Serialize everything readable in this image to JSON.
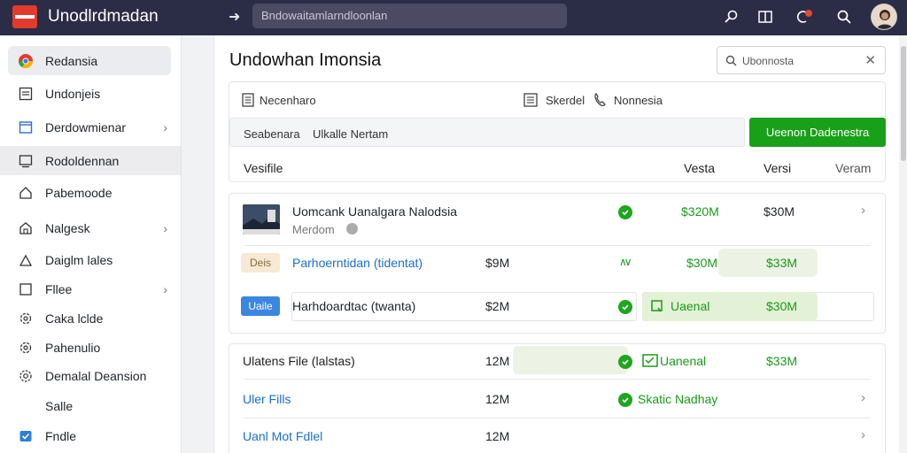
{
  "app": {
    "title": "Unodlrdmadan"
  },
  "search": {
    "placeholder": "Bndowaitamlarndloonlan"
  },
  "sidebar": {
    "items": [
      {
        "label": "Redansia",
        "icon": "chrome-icon",
        "chevron": false
      },
      {
        "label": "Undonjeis",
        "icon": "document-icon",
        "chevron": false
      },
      {
        "label": "Derdowmienar",
        "icon": "window-icon",
        "chevron": true
      },
      {
        "label": "Rodoldennan",
        "icon": "monitor-icon",
        "chevron": false
      },
      {
        "label": "Pabemoode",
        "icon": "home-icon",
        "chevron": false
      },
      {
        "label": "Nalgesk",
        "icon": "house-icon",
        "chevron": true
      },
      {
        "label": "Daiglm lales",
        "icon": "user-icon",
        "chevron": false
      },
      {
        "label": "Fllee",
        "icon": "square-icon",
        "chevron": true
      },
      {
        "label": "Caka lclde",
        "icon": "gear-icon",
        "chevron": false
      },
      {
        "label": "Pahenulio",
        "icon": "gear-icon",
        "chevron": false
      },
      {
        "label": "Demalal Deansion",
        "icon": "cog-icon",
        "chevron": false
      },
      {
        "label": "Salle",
        "icon": "",
        "chevron": false
      },
      {
        "label": "Fndle",
        "icon": "checkbox-icon",
        "chevron": false
      }
    ]
  },
  "main": {
    "title": "Undowhan Imonsia",
    "filter": {
      "value": "Ubonnosta"
    },
    "toolbar": {
      "item1": "Necenharo",
      "item2": "Skerdel",
      "item3": "Nonnesia",
      "sub1": "Seabenara",
      "sub2": "Ulkalle Nertam",
      "button": "Ueenon Dadenestra"
    },
    "headers": {
      "c1": "Vesifile",
      "c2": "Vesta",
      "c3": "Versi",
      "c4": "Veram"
    },
    "group1": {
      "row1": {
        "name": "Uomcank Uanalgara Nalodsia",
        "sub": "Merdom",
        "v1": "$320M",
        "v2": "$30M"
      },
      "row2": {
        "badge": "Deis",
        "name": "Parhoerntidan (tidentat)",
        "size": "$9M",
        "mark": "∧∨",
        "v1": "$30M",
        "v2": "$33M"
      },
      "row3": {
        "badge": "Uaile",
        "name": "Harhdoardtac (twanta)",
        "size": "$2M",
        "status": "Uaenal",
        "v2": "$30M"
      }
    },
    "group2": {
      "row1": {
        "name": "Ulatens File (lalstas)",
        "size": "12M",
        "status": "Uanenal",
        "v2": "$33M"
      },
      "row2": {
        "name": "Uler Fills",
        "size": "12M",
        "status": "Skatic Nadhay"
      },
      "row3": {
        "name": "Uanl Mot Fdlel",
        "size": "12M"
      }
    }
  },
  "colors": {
    "topbar": "#2b2c45",
    "accent": "#19a019",
    "link": "#1a6fd0",
    "brand": "#e23a2d"
  }
}
